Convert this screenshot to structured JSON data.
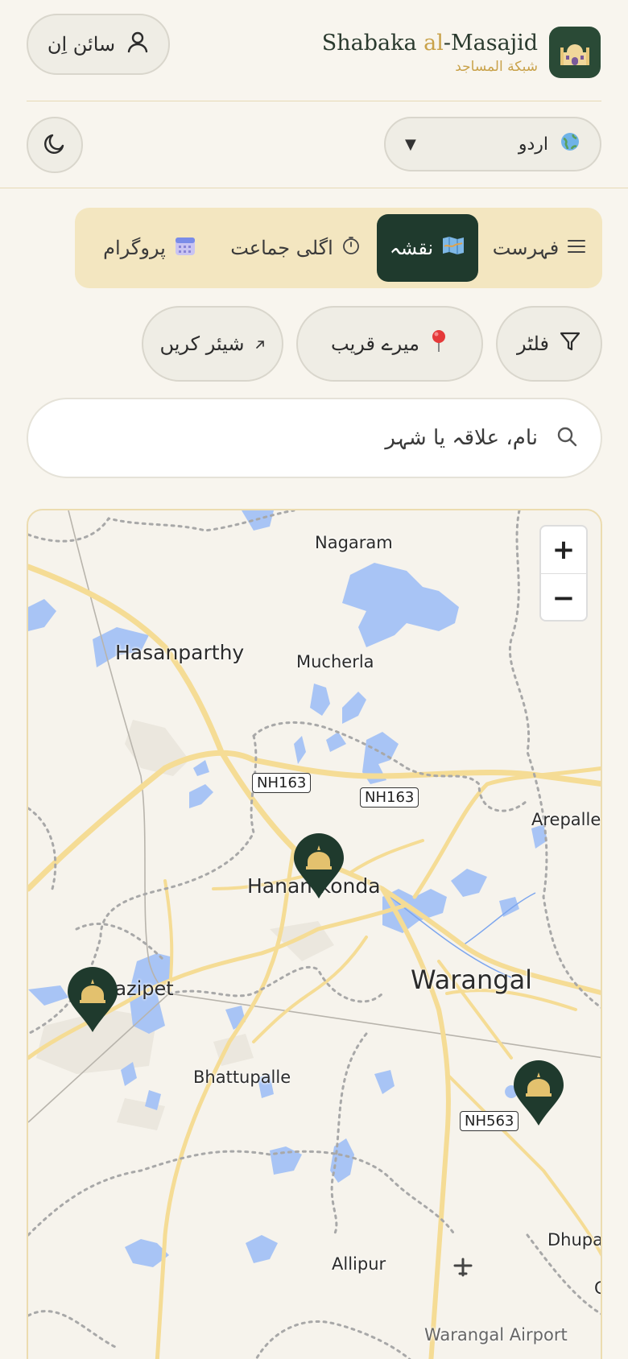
{
  "header": {
    "signin_label": "سائن اِن",
    "brand_prefix": "Shabaka ",
    "brand_al": "al",
    "brand_suffix": "-Masajid",
    "brand_subtitle": "شبکة المساجد",
    "logo_icon": "mosque-icon"
  },
  "controls": {
    "language_value": "اردو",
    "language_icon": "globe-icon",
    "theme_icon": "moon-icon"
  },
  "tabs": [
    {
      "label": "پروگرام",
      "icon": "calendar-icon"
    },
    {
      "label": "اگلی جماعت",
      "icon": "stopwatch-icon"
    },
    {
      "label": "نقشہ",
      "icon": "map-icon",
      "active": true
    },
    {
      "label": "فہرست",
      "icon": "list-icon"
    }
  ],
  "actions": {
    "share_label": "شیئر کریں",
    "near_label": "میرے قریب",
    "filter_label": "فلٹر"
  },
  "search": {
    "placeholder": "نام، علاقہ یا شہر"
  },
  "map": {
    "zoom_in": "+",
    "zoom_out": "−",
    "places": [
      "Nagaram",
      "Hasanparthy",
      "Mucherla",
      "Arepalle",
      "Hanamkonda",
      "Kazipet",
      "Warangal",
      "Bhattupalle",
      "Allipur",
      "Dhupa",
      "G",
      "Warangal Airport"
    ],
    "roads": [
      "NH163",
      "NH163",
      "NH563"
    ],
    "colors": {
      "water": "#a8c4f5",
      "road": "#f5dc95",
      "boundary": "#a8a8a8",
      "pin": "#1f3a2d",
      "pin_accent": "#e3c16e"
    }
  }
}
